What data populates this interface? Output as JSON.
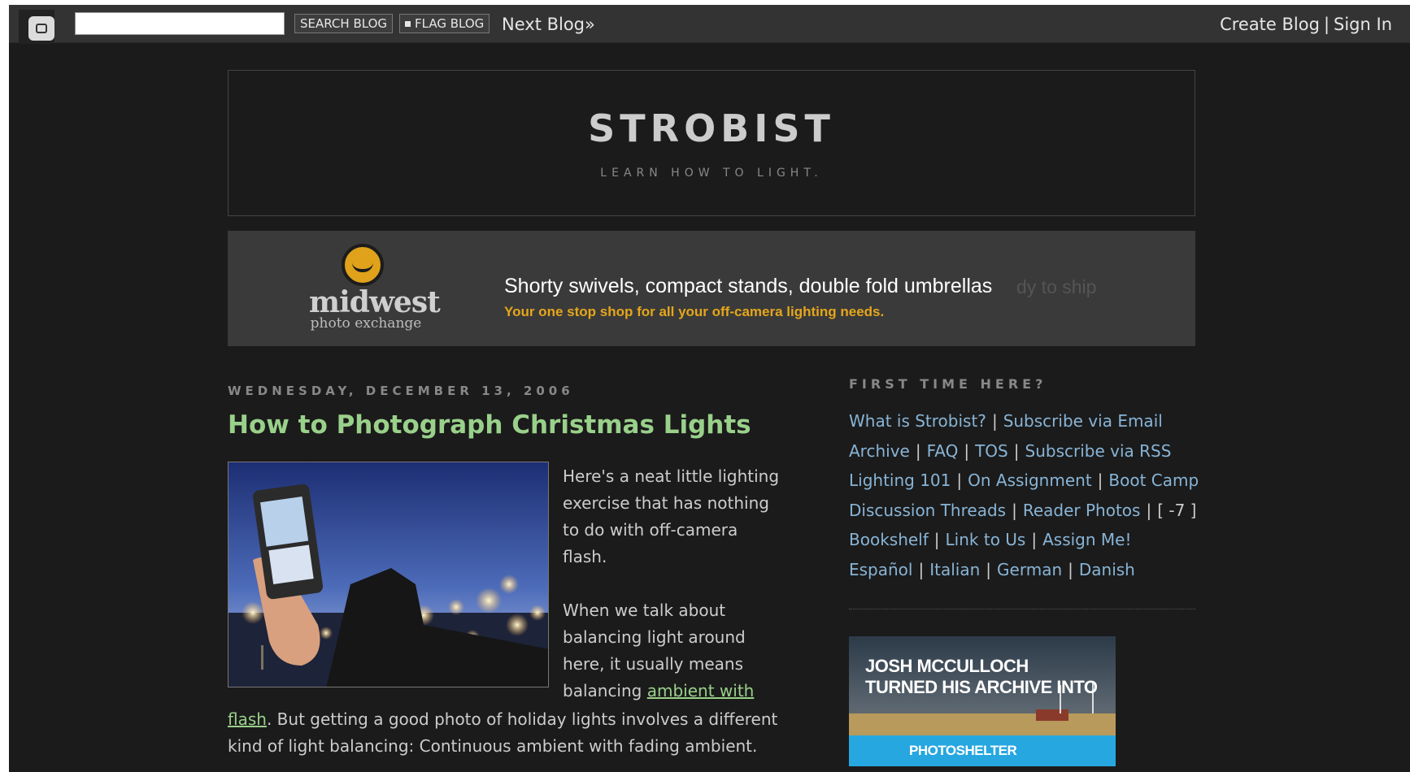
{
  "navbar": {
    "search_button": "SEARCH BLOG",
    "flag_button": "FLAG BLOG",
    "next_blog": "Next Blog»",
    "create_blog": "Create Blog",
    "separator": "|",
    "sign_in": "Sign In"
  },
  "header": {
    "title": "STROBIST",
    "description": "LEARN HOW TO LIGHT."
  },
  "banner": {
    "brand": "midwest",
    "brand_sub": "photo exchange",
    "headline": "Shorty swivels, compact stands, double fold umbrellas",
    "ghost_text": "dy to ship",
    "subline": "Your one stop shop for all your off-camera lighting needs."
  },
  "post": {
    "date": "WEDNESDAY, DECEMBER 13, 2006",
    "title": "How to Photograph Christmas Lights",
    "para1": "Here's a neat little lighting exercise that has nothing to do with off-camera flash.",
    "para2_start": "When we talk about balancing light around here, it usually means balancing ",
    "link_ambient": "ambient with",
    "link_flash": "flash",
    "para2_end": ". But getting a good photo of holiday lights involves a different kind of light balancing: Continuous ambient with fading ambient."
  },
  "sidebar": {
    "heading": "FIRST TIME HERE?",
    "rows": [
      [
        "What is Strobist?",
        "Subscribe via Email"
      ],
      [
        "Archive",
        "FAQ",
        "TOS",
        "Subscribe via RSS"
      ],
      [
        "Lighting 101",
        "On Assignment",
        "Boot Camp"
      ],
      [
        "Discussion Threads",
        "Reader Photos"
      ],
      [
        "Bookshelf",
        "Link to Us",
        "Assign Me!"
      ],
      [
        "Español",
        "Italian",
        "German",
        "Danish"
      ]
    ],
    "extra_counter": "[ -7 ]"
  },
  "ad": {
    "line1": "JOSH MCCULLOCH",
    "line2": "TURNED HIS ARCHIVE INTO",
    "brand": "PHOTOSHELTER"
  },
  "colors": {
    "background": "#1b1b1b",
    "title_green": "#99d08a",
    "link_blue": "#88b4d6",
    "banner_orange": "#e5a61b",
    "photoshelter_blue": "#26a7e0"
  }
}
